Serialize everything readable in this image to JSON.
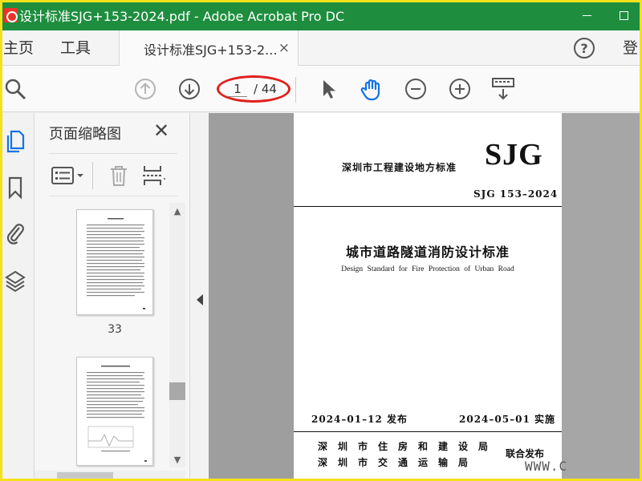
{
  "window": {
    "title": "设计标准SJG+153-2024.pdf - Adobe Acrobat Pro DC"
  },
  "tabs": {
    "home": "主页",
    "tools": "工具",
    "document": "设计标准SJG+153-2...",
    "document_close": "×",
    "help": "?",
    "login": "登"
  },
  "toolbar": {
    "current_page": "1",
    "total_pages": "/ 44"
  },
  "panel": {
    "title": "页面缩略图",
    "close": "✕",
    "thumbnails": [
      {
        "label": "33"
      },
      {
        "label": ""
      }
    ]
  },
  "page": {
    "standard_line": "深圳市工程建设地方标准",
    "logo": "SJG",
    "code": "SJG 153–2024",
    "title_cn": "城市道路隧道消防设计标准",
    "title_en": "Design Standard for Fire Protection of Urban Road",
    "issue_date": "2024–01–12 发布",
    "effective_date": "2024–05–01 实施",
    "org1": "深圳市住房和建设局",
    "org2": "深圳市交通运输局",
    "joint_release": "联合发布"
  },
  "watermark": "WWW.C",
  "colors": {
    "titlebar": "#1e8e3e",
    "highlight_ring": "#e0201c",
    "active_icon": "#1473e6",
    "frame": "#f5e11a"
  }
}
